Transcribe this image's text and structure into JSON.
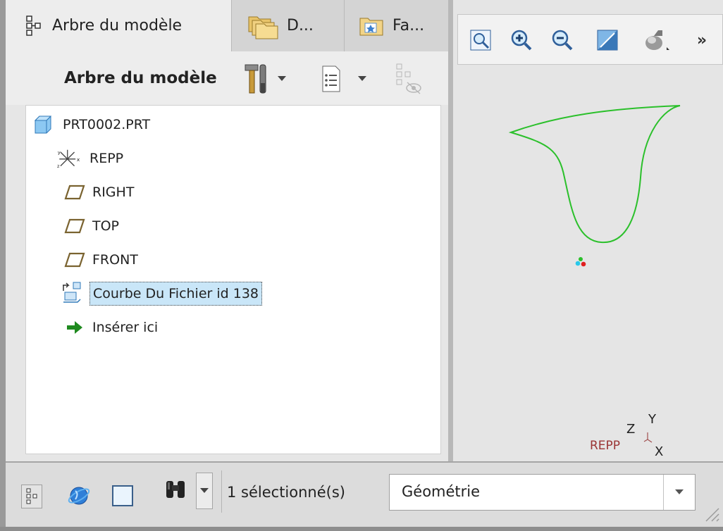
{
  "tabs": {
    "model_tree": "Arbre du modèle",
    "d_tab": "D...",
    "fa_tab": "Fa..."
  },
  "tree_toolbar": {
    "title": "Arbre du modèle",
    "settings_icon": "hammer-wrench-icon",
    "display_icon": "list-icon",
    "visibility_icon": "tree-eye-icon"
  },
  "tree": {
    "items": [
      {
        "label": "PRT0002.PRT",
        "icon": "part-cube-icon"
      },
      {
        "label": "REPP",
        "icon": "csys-icon"
      },
      {
        "label": "RIGHT",
        "icon": "datum-plane-icon"
      },
      {
        "label": "TOP",
        "icon": "datum-plane-icon"
      },
      {
        "label": "FRONT",
        "icon": "datum-plane-icon"
      },
      {
        "label": "Courbe Du Fichier id 138",
        "icon": "curve-from-file-icon",
        "selected": true
      },
      {
        "label": "Insérer ici",
        "icon": "insert-here-arrow-icon"
      }
    ]
  },
  "graphics_toolbar": {
    "icons": [
      "refit-icon",
      "zoom-in-icon",
      "zoom-out-icon",
      "repaint-icon",
      "display-style-icon",
      "more-chevron-icon"
    ],
    "more_label": "»"
  },
  "viewport": {
    "curve_color": "#2bc02b",
    "csys_label": "REPP",
    "axis_x": "X",
    "axis_y": "Y",
    "axis_z": "Z"
  },
  "status_bar": {
    "selection_text": "1 sélectionné(s)",
    "filter_value": "Géométrie"
  }
}
